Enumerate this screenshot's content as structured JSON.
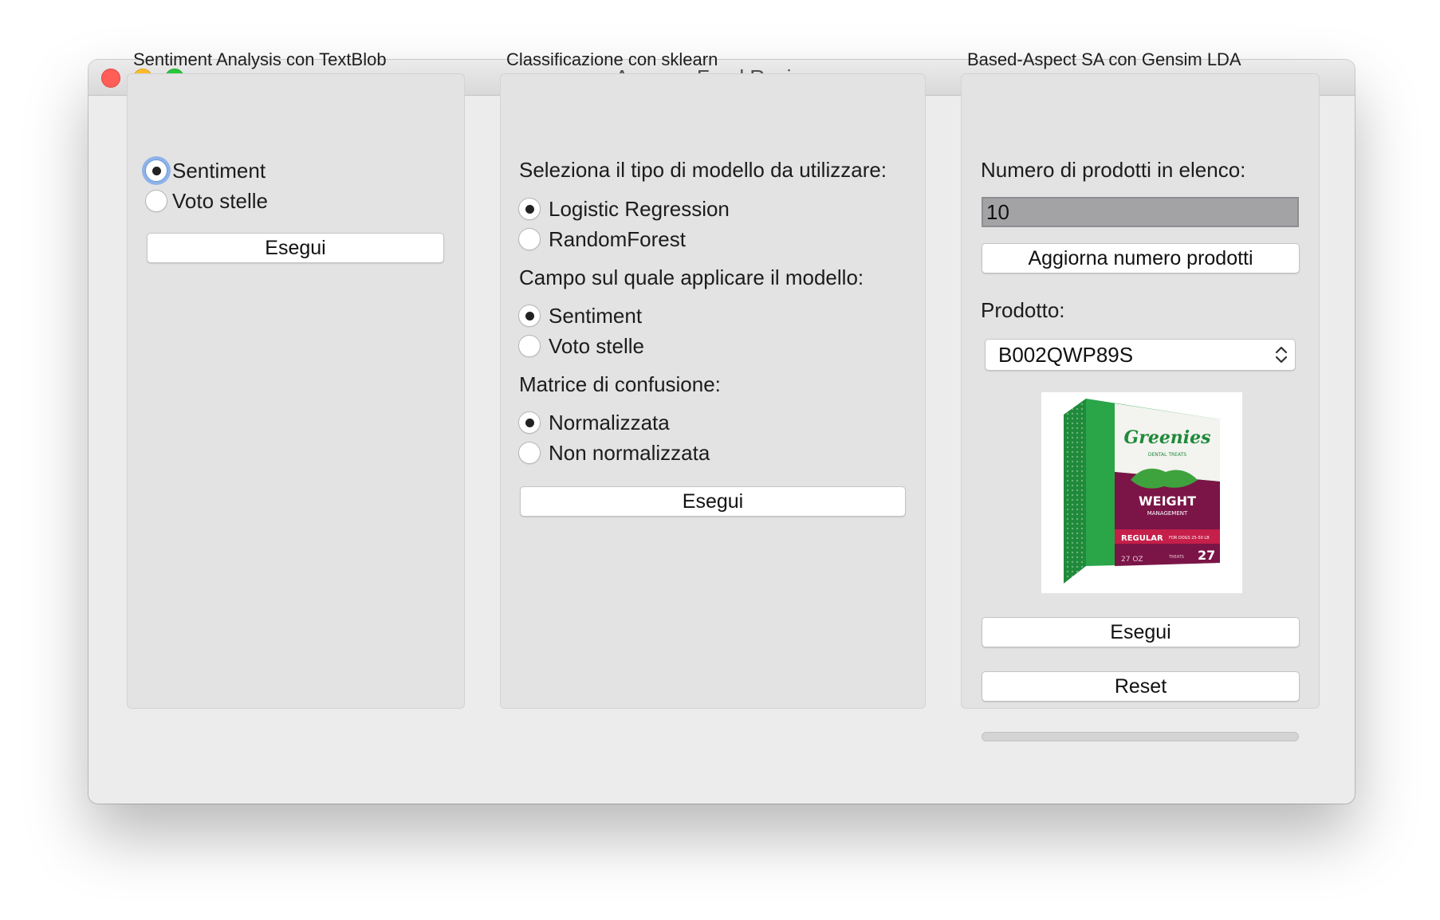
{
  "window": {
    "title": "Amazon Food Reviews"
  },
  "textblob": {
    "group_label": "Sentiment Analysis con TextBlob",
    "options": [
      "Sentiment",
      "Voto stelle"
    ],
    "selected": "Sentiment",
    "run_label": "Esegui"
  },
  "sklearn": {
    "group_label": "Classificazione con sklearn",
    "model_prompt": "Seleziona il tipo di modello da utilizzare:",
    "models": [
      "Logistic Regression",
      "RandomForest"
    ],
    "model_selected": "Logistic Regression",
    "field_prompt": "Campo sul quale applicare il modello:",
    "fields": [
      "Sentiment",
      "Voto stelle"
    ],
    "field_selected": "Sentiment",
    "matrix_prompt": "Matrice di confusione:",
    "matrix_options": [
      "Normalizzata",
      "Non normalizzata"
    ],
    "matrix_selected": "Normalizzata",
    "run_label": "Esegui"
  },
  "lda": {
    "group_label": "Based-Aspect SA con Gensim LDA",
    "count_prompt": "Numero di prodotti in elenco:",
    "count_value": "10",
    "update_label": "Aggiorna numero prodotti",
    "product_prompt": "Prodotto:",
    "product_selected": "B002QWP89S",
    "image": {
      "brand": "Greenies",
      "subtitle": "DENTAL TREATS",
      "line1": "WEIGHT",
      "line2": "MANAGEMENT",
      "size": "REGULAR",
      "size_note": "FOR DOGS 25-50 LB",
      "weight": "27 OZ",
      "count_note": "TREATS",
      "count": "27"
    },
    "run_label": "Esegui",
    "reset_label": "Reset",
    "progress": 0
  },
  "colors": {
    "close": "#ff5f57",
    "minimize": "#febc2e",
    "maximize": "#28c840",
    "focus_ring": "#8fb2e8"
  }
}
